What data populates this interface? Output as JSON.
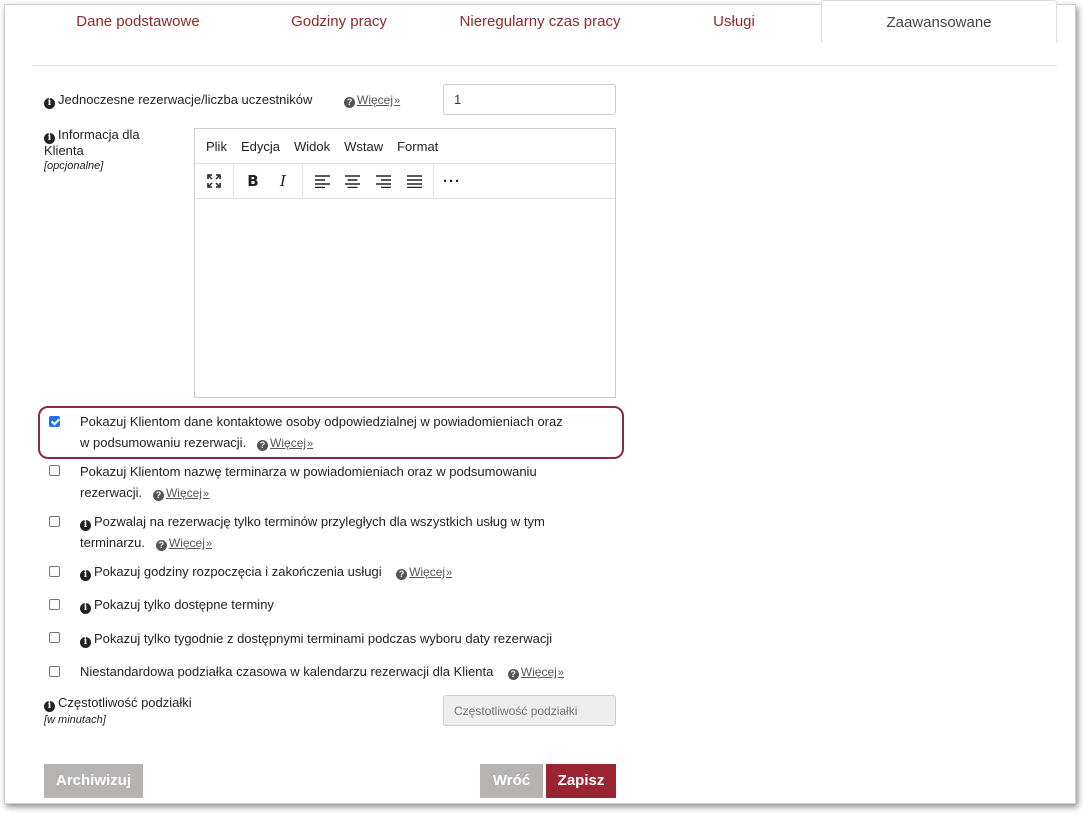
{
  "tabs": [
    {
      "label": "Dane podstawowe",
      "active": false
    },
    {
      "label": "Godziny pracy",
      "active": false
    },
    {
      "label": "Nieregularny czas pracy",
      "active": false
    },
    {
      "label": "Usługi",
      "active": false
    },
    {
      "label": "Zaawansowane",
      "active": true
    }
  ],
  "more_label": "Więcej",
  "concurrent": {
    "label": "Jednoczesne rezerwacje/liczba uczestników",
    "value": "1"
  },
  "client_info": {
    "label": "Informacja dla Klienta",
    "optional": "[opcjonalne]"
  },
  "editor": {
    "menu": [
      "Plik",
      "Edycja",
      "Widok",
      "Wstaw",
      "Format"
    ],
    "toolbar_icons": [
      "fullscreen-icon",
      "bold-icon",
      "italic-icon",
      "align-left-icon",
      "align-center-icon",
      "align-right-icon",
      "align-justify-icon",
      "more-icon"
    ],
    "content": ""
  },
  "checkboxes": [
    {
      "line1": "Pokazuj Klientom dane kontaktowe osoby odpowiedzialnej w powiadomieniach oraz",
      "line2": "w podsumowaniu rezerwacji.",
      "checked": true,
      "info": false,
      "more": true
    },
    {
      "line1": "Pokazuj Klientom nazwę terminarza w powiadomieniach oraz w podsumowaniu",
      "line2": "rezerwacji.",
      "checked": false,
      "info": false,
      "more": true
    },
    {
      "line1": "Pozwalaj na rezerwację tylko terminów przyległych dla wszystkich usług w tym",
      "line2": "terminarzu.",
      "checked": false,
      "info": true,
      "more": true
    },
    {
      "line1": "Pokazuj godziny rozpoczęcia i zakończenia usługi",
      "line2": "",
      "checked": false,
      "info": true,
      "more": true
    },
    {
      "line1": "Pokazuj tylko dostępne terminy",
      "line2": "",
      "checked": false,
      "info": true,
      "more": false
    },
    {
      "line1": "Pokazuj tylko tygodnie z dostępnymi terminami podczas wyboru daty rezerwacji",
      "line2": "",
      "checked": false,
      "info": true,
      "more": false
    },
    {
      "line1": "Niestandardowa podziałka czasowa w kalendarzu rezerwacji dla Klienta",
      "line2": "",
      "checked": false,
      "info": false,
      "more": true
    }
  ],
  "frequency": {
    "label": "Częstotliwość podziałki",
    "unit": "[w minutach]",
    "placeholder": "Częstotliwość podziałki"
  },
  "buttons": {
    "archive": "Archiwizuj",
    "back": "Wróć",
    "save": "Zapisz"
  },
  "colors": {
    "accent": "#9b2433",
    "tab_text": "#8b2b2b",
    "checkbox_checked": "#1a73e8",
    "button_grey": "#b6b3b3"
  }
}
